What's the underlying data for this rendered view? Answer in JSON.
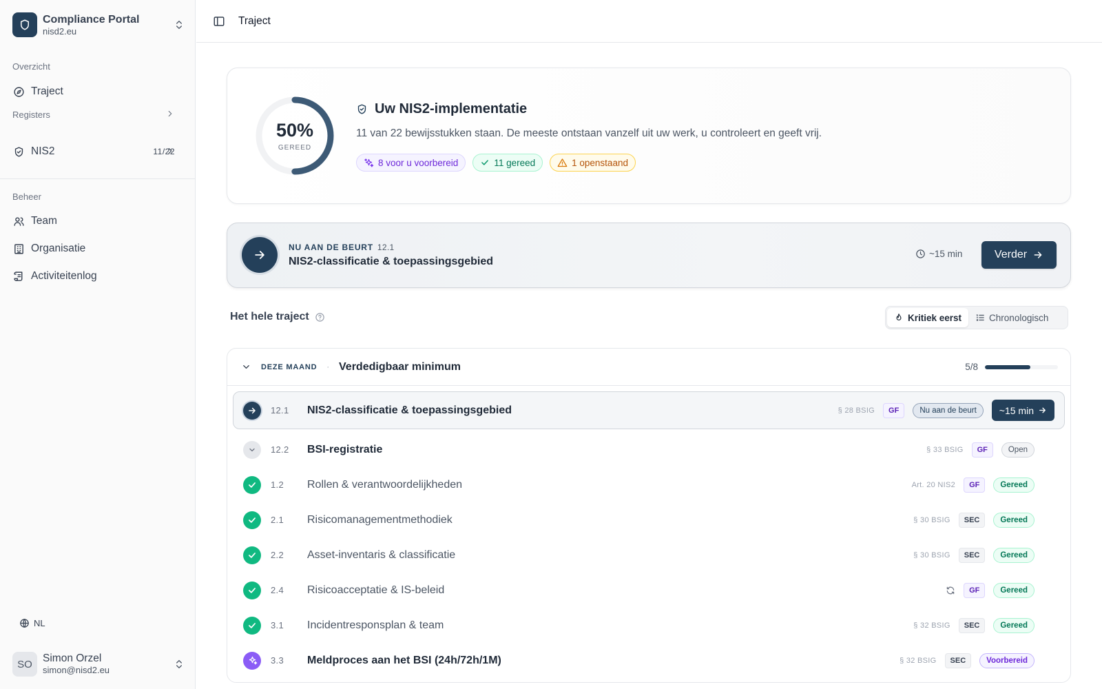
{
  "brand": {
    "name": "Compliance Portal",
    "domain": "nisd2.eu",
    "accent": "#24405a"
  },
  "sidebar": {
    "overview_label": "Overzicht",
    "traject_label": "Traject",
    "registers_label": "Registers",
    "nis2_label": "NIS2",
    "nis2_count": "11/22",
    "beheer_label": "Beheer",
    "team_label": "Team",
    "organisatie_label": "Organisatie",
    "activiteitenlog_label": "Activiteitenlog",
    "lang": "NL"
  },
  "user": {
    "initials": "SO",
    "name": "Simon Orzel",
    "email": "simon@nisd2.eu"
  },
  "topbar": {
    "title": "Traject"
  },
  "hero": {
    "percent": "50%",
    "percent_value": 0.5,
    "percent_label": "GEREED",
    "title": "Uw NIS2-implementatie",
    "description": "11 van 22 bewijsstukken staan. De meeste ontstaan vanzelf uit uw werk, u controleert en geeft vrij.",
    "pill_prepared": "8 voor u voorbereid",
    "pill_done": "11 gereed",
    "pill_open": "1 openstaand"
  },
  "next": {
    "eyebrow": "NU AAN DE BEURT",
    "code": "12.1",
    "title": "NIS2-classificatie & toepassingsgebied",
    "time": "~15 min",
    "button": "Verder"
  },
  "section": {
    "title": "Het hele traject",
    "sort_critical": "Kritiek eerst",
    "sort_chrono": "Chronologisch"
  },
  "group": {
    "tag": "DEZE MAAND",
    "dot": "·",
    "title": "Verdedigbaar minimum",
    "progress": "5/8",
    "progress_value": 0.625
  },
  "rows": [
    {
      "num": "12.1",
      "title": "NIS2-classificatie & toepassingsgebied",
      "ref": "§ 28 BSIG",
      "tag": "GF",
      "badge": "Nu aan de beurt",
      "action": "~15 min"
    },
    {
      "num": "12.2",
      "title": "BSI-registratie",
      "ref": "§ 33 BSIG",
      "tag": "GF",
      "badge": "Open"
    },
    {
      "num": "1.2",
      "title": "Rollen & verantwoordelijkheden",
      "ref": "Art. 20 NIS2",
      "tag": "GF",
      "badge": "Gereed"
    },
    {
      "num": "2.1",
      "title": "Risicomanagementmethodiek",
      "ref": "§ 30 BSIG",
      "tag": "SEC",
      "badge": "Gereed"
    },
    {
      "num": "2.2",
      "title": "Asset-inventaris & classificatie",
      "ref": "§ 30 BSIG",
      "tag": "SEC",
      "badge": "Gereed"
    },
    {
      "num": "2.4",
      "title": "Risicoacceptatie & IS-beleid",
      "tag": "GF",
      "badge": "Gereed"
    },
    {
      "num": "3.1",
      "title": "Incidentresponsplan & team",
      "ref": "§ 32 BSIG",
      "tag": "SEC",
      "badge": "Gereed"
    },
    {
      "num": "3.3",
      "title": "Meldproces aan het BSI (24h/72h/1M)",
      "ref": "§ 32 BSIG",
      "tag": "SEC",
      "badge": "Voorbereid"
    }
  ]
}
